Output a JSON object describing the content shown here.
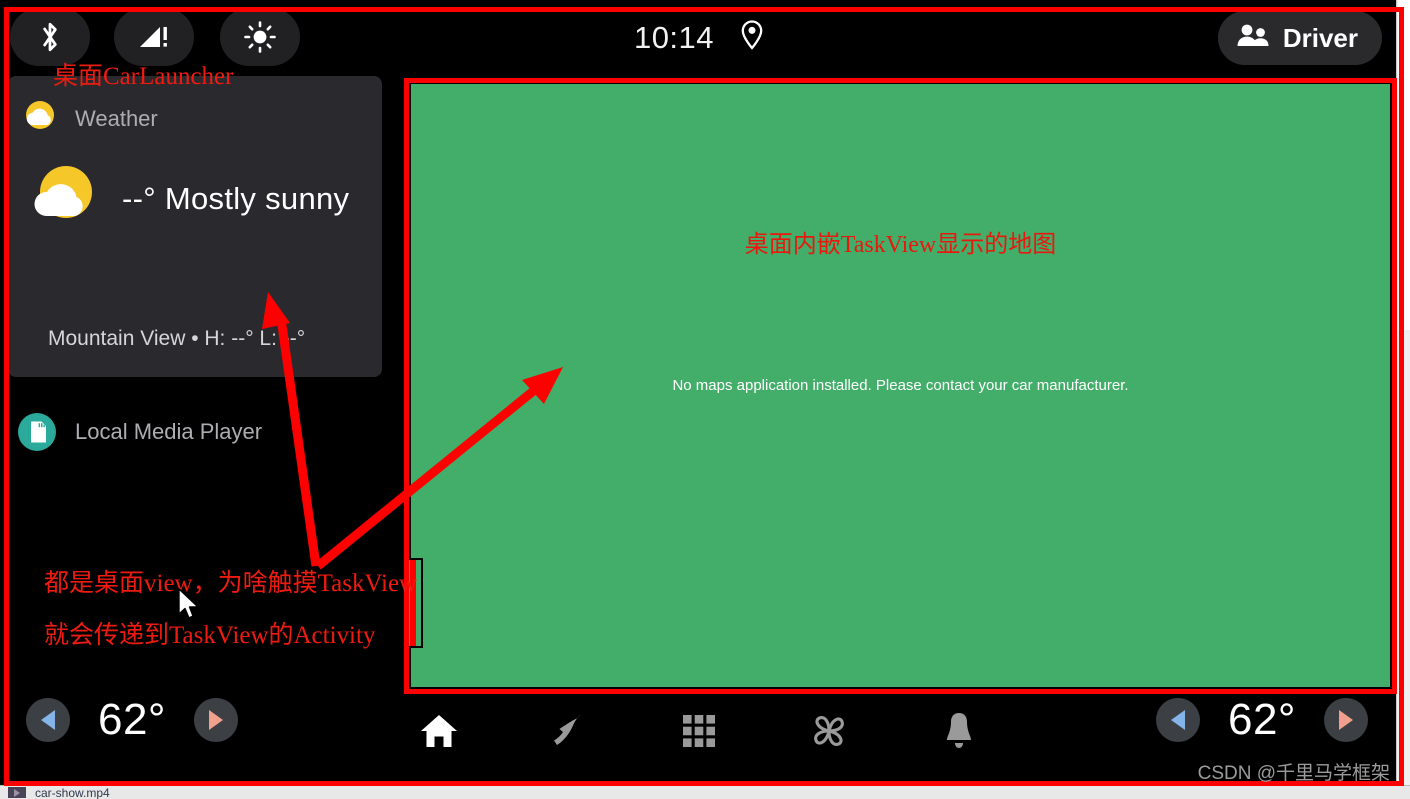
{
  "status_bar": {
    "bluetooth_icon": "bluetooth-icon",
    "signal_icon": "cellular-signal-alert-icon",
    "brightness_icon": "brightness-sun-icon",
    "clock": "10:14",
    "location_icon": "location-pin-icon",
    "profile": {
      "label": "Driver",
      "icon": "people-group-icon"
    }
  },
  "weather_card": {
    "title": "Weather",
    "title_icon": "partly-cloudy-small-icon",
    "condition_icon": "partly-cloudy-large-icon",
    "condition": "--° Mostly sunny",
    "location_hilo": "Mountain View • H: --° L: --°"
  },
  "media": {
    "title": "Local Media Player",
    "icon": "sd-card-icon"
  },
  "taskview": {
    "message": "No maps application installed. Please contact your car manufacturer.",
    "background_color": "#43ad6a"
  },
  "nav_bar": {
    "left_temp": {
      "decrease_icon": "triangle-left-icon",
      "value": "62°",
      "increase_icon": "triangle-right-icon"
    },
    "right_temp": {
      "decrease_icon": "triangle-left-icon",
      "value": "62°",
      "increase_icon": "triangle-right-icon"
    },
    "icons": [
      {
        "name": "home-icon",
        "active": true
      },
      {
        "name": "phone-icon",
        "active": false
      },
      {
        "name": "apps-grid-icon",
        "active": false
      },
      {
        "name": "climate-fan-icon",
        "active": false
      },
      {
        "name": "notification-bell-icon",
        "active": false
      }
    ]
  },
  "annotations": {
    "color": "#ee1b10",
    "launcher_label": "桌面CarLauncher",
    "taskview_label": "桌面内嵌TaskView显示的地图",
    "note_line1": "都是桌面view，为啥触摸TaskView",
    "note_line2": "就会传递到TaskView的Activity"
  },
  "watermark": "CSDN @千里马学框架",
  "taskbar": {
    "file_label": "car-show.mp4"
  }
}
